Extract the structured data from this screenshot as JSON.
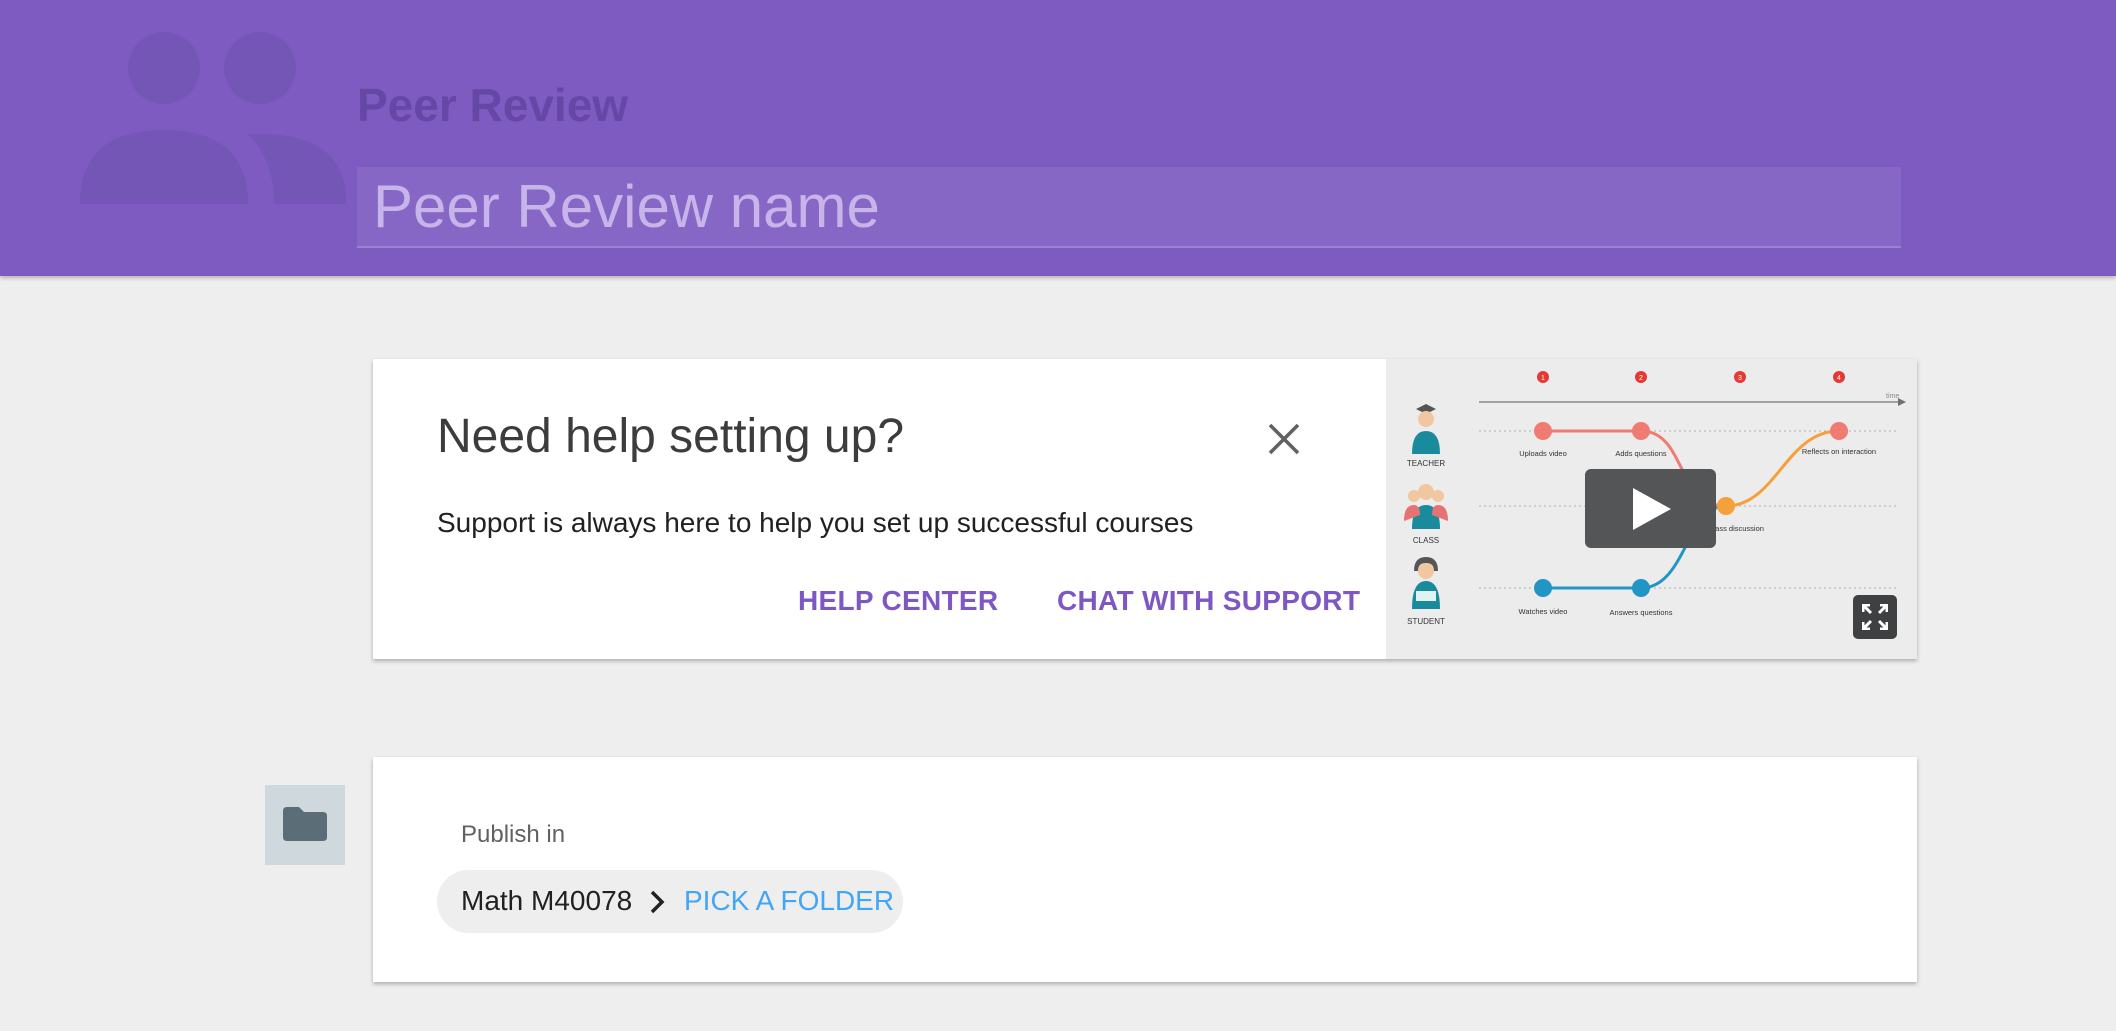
{
  "header": {
    "title": "Peer Review",
    "name_placeholder": "Peer Review name",
    "icon": "people-icon",
    "background_color": "#7e5bc1"
  },
  "help_card": {
    "title": "Need help setting up?",
    "description": "Support is always here to help you set up successful courses",
    "help_center_label": "HELP CENTER",
    "chat_support_label": "CHAT WITH SUPPORT",
    "close_icon": "close-icon",
    "link_color": "#7e57c2"
  },
  "video": {
    "roles": [
      "TEACHER",
      "CLASS",
      "STUDENT"
    ],
    "steps": [
      "1",
      "2",
      "3",
      "4"
    ],
    "axis_label": "time",
    "events": {
      "uploads_video": "Uploads video",
      "adds_questions": "Adds questions",
      "reflects": "Reflects on interaction",
      "class_discussion": "Class discussion",
      "watches_video": "Watches video",
      "answers_questions": "Answers questions"
    },
    "play_icon": "play-icon",
    "fullscreen_icon": "fullscreen-icon"
  },
  "publish": {
    "label": "Publish in",
    "folder_path": "Math M40078",
    "pick_folder_label": "PICK A FOLDER",
    "folder_icon": "folder-icon",
    "pick_color": "#42a5f5"
  }
}
